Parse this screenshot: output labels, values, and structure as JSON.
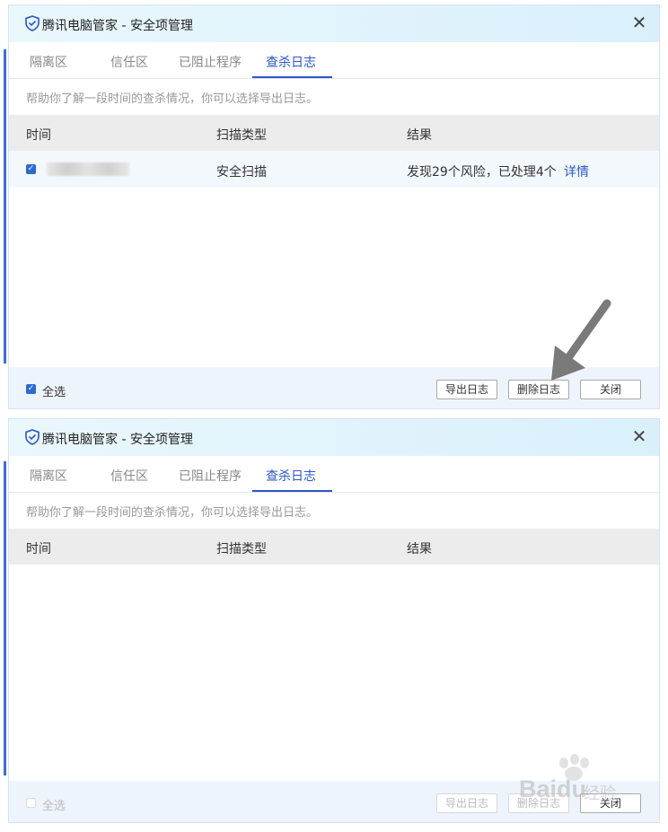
{
  "window": {
    "title": "腾讯电脑管家 - 安全项管理"
  },
  "tabs": [
    {
      "label": "隔离区"
    },
    {
      "label": "信任区"
    },
    {
      "label": "已阻止程序"
    },
    {
      "label": "查杀日志",
      "active": true
    }
  ],
  "hint": "帮助你了解一段时间的查杀情况，你可以选择导出日志。",
  "table": {
    "headers": [
      "时间",
      "扫描类型",
      "结果"
    ],
    "rows": [
      {
        "checked": true,
        "time": "",
        "scan_type": "安全扫描",
        "result": "发现29个风险，已处理4个",
        "detail_link": "详情"
      }
    ]
  },
  "footer": {
    "select_all": "全选",
    "export_button": "导出日志",
    "delete_button": "删除日志",
    "close_button": "关闭"
  },
  "watermark": {
    "brand": "Baidu",
    "suffix": "经验"
  },
  "colors": {
    "accent": "#2a56c6",
    "checkbox": "#2d6ad0",
    "arrow": "#7a7a7a"
  },
  "icons": [
    "tencent-shield-icon",
    "close-icon",
    "checkbox-checked-icon",
    "pointer-arrow-icon"
  ]
}
